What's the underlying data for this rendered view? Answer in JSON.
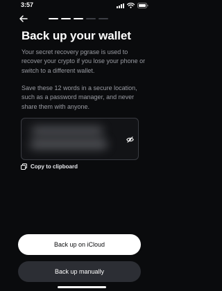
{
  "status_bar": {
    "time": "3:57"
  },
  "progress": {
    "total_steps": 5,
    "current_step": 3
  },
  "header": {
    "title": "Back up your wallet"
  },
  "body": {
    "paragraph1": "Your secret recovery pgrase is used to recover your crypto if you lose your phone or switch to a different wallet.",
    "paragraph2": "Save these 12 words in a secure location, such as a password manager, and never share them with anyone."
  },
  "phrase_box": {
    "state": "hidden",
    "reveal_icon": "eye-slash-icon"
  },
  "copy": {
    "label": "Copy to clipboard",
    "icon": "copy-icon"
  },
  "actions": {
    "primary_label": "Back up on iCloud",
    "secondary_label": "Back up manually"
  }
}
